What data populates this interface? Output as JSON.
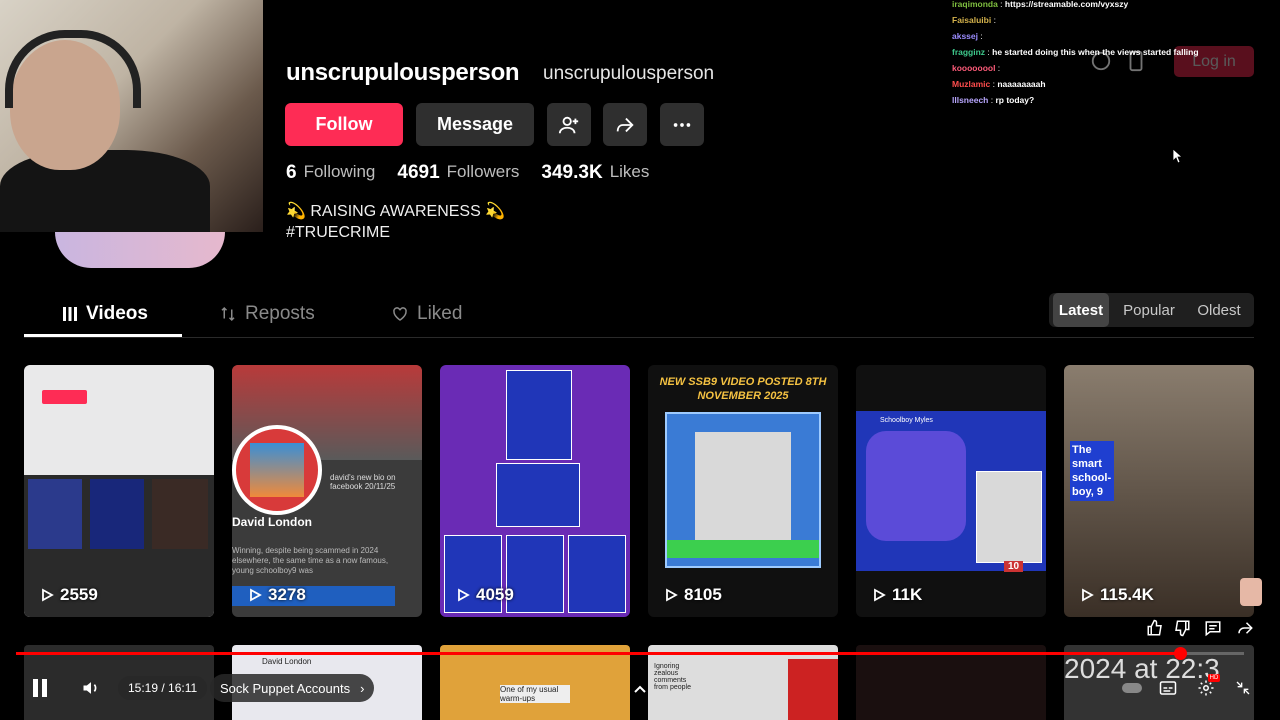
{
  "profile": {
    "username": "unscrupulousperson",
    "nickname": "unscrupulousperson",
    "follow_label": "Follow",
    "message_label": "Message",
    "following_count": "6",
    "following_label": "Following",
    "followers_count": "4691",
    "followers_label": "Followers",
    "likes_count": "349.3K",
    "likes_label": "Likes",
    "bio_line1": "💫 RAISING AWARENESS 💫",
    "bio_line2": "#TRUECRIME"
  },
  "tabs": [
    {
      "label": "Videos",
      "icon": "grid-icon"
    },
    {
      "label": "Reposts",
      "icon": "repost-icon"
    },
    {
      "label": "Liked",
      "icon": "heart-icon"
    }
  ],
  "sort": [
    "Latest",
    "Popular",
    "Oldest"
  ],
  "header": {
    "login_label": "Log in"
  },
  "videos": [
    {
      "views": "2559"
    },
    {
      "views": "3278",
      "title": "David London",
      "subtitle": "david's new bio on facebook 20/11/25",
      "body": "Winning, despite being scammed in 2024 elsewhere, the same time as a now famous, young schoolboy9 was"
    },
    {
      "views": "4059"
    },
    {
      "views": "8105",
      "caption": "NEW SSB9 VIDEO POSTED 8TH NOVEMBER 2025"
    },
    {
      "views": "11K",
      "label_a": "Schoolboy Myles",
      "label_b": "10"
    },
    {
      "views": "115.4K",
      "caption": "The smart school-boy, 9"
    }
  ],
  "row2": [
    {
      "text": ""
    },
    {
      "text": "David London"
    },
    {
      "text": "One of my usual warm-ups"
    },
    {
      "text": "Ignoring zealous comments from people"
    },
    {
      "text": ""
    },
    {
      "text": "2024 at 22:3"
    }
  ],
  "chat": [
    {
      "user": "iraqimonda",
      "color": "#7fbf3f",
      "msg": "https://streamable.com/vyxszy"
    },
    {
      "user": "Faisaluibi",
      "color": "#d4b24c",
      "msg": ""
    },
    {
      "user": "akssej",
      "color": "#9b8cff",
      "msg": ""
    },
    {
      "user": "fragginz",
      "color": "#3ec98c",
      "msg": "he started doing this when the views started falling"
    },
    {
      "user": "koooooool",
      "color": "#ff5c7a",
      "msg": ""
    },
    {
      "user": "Muzlamic",
      "color": "#ff4d4d",
      "msg": "naaaaaaaah"
    },
    {
      "user": "lllsneech",
      "color": "#b9a7ff",
      "msg": "rp today?"
    }
  ],
  "player": {
    "time": "15:19 / 16:11",
    "chapter": "Sock Puppet Accounts",
    "progress": 0.9475
  },
  "colors": {
    "accent": "#fe2c55",
    "progress": "#ff0000"
  }
}
